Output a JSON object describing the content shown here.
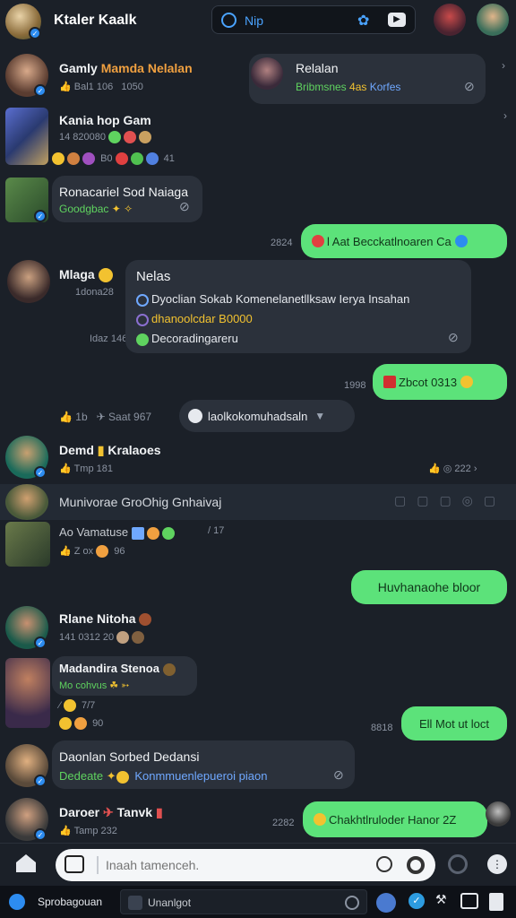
{
  "header": {
    "title": "Ktaler Kaalk",
    "search_value": "Nip"
  },
  "chats": {
    "c1_name": "Gamly",
    "c1_name2": "Mamda Nelalan",
    "c1_meta": "Bal1 106",
    "c1_meta2": "1050",
    "c2_name": "Kania hop Gam",
    "c2_meta": "14 820080",
    "c2_reactions": "B0",
    "c2_react2": "41",
    "c3_name": "Ronacariel Sod Naiaga",
    "c3_meta": "Goodgbac",
    "c4_name": "Mlaga",
    "c4_meta": "1dona28",
    "c4_meta2": "Idaz 146",
    "c5_name": "Demd",
    "c5_name2": "Kralaoes",
    "c5_meta": "Tmp 181",
    "c5_right": "222",
    "c6_text": "Munivorae GroOhig Gnhaivaj",
    "c7_text": "Ao Vamatuse",
    "c7_right": "17",
    "c7_meta": "Z ox",
    "c7_meta2": "96",
    "c8_name": "Rlane Nitoha",
    "c8_meta": "141 0312 20",
    "c9_name": "Madandira Stenoa",
    "c9_meta": "Mo cohvus",
    "c9_meta2": "7/7",
    "c9_meta3": "90",
    "c10_name": "Daonlan Sorbed Dedansi",
    "c10_meta": "Dedeate",
    "c10_meta2": "Konmmuenlepueroi piaon",
    "c11_name": "Daroer",
    "c11_name2": "Tanvk",
    "c11_meta": "Tamp 232"
  },
  "right_bubbles": {
    "relaton_title": "Relalan",
    "relaton_sub": "Bribmsnes",
    "relaton_sub2": "4as",
    "relaton_sub3": "Korfes",
    "b_time1": "2824",
    "b_green1": "l Aat Becckatlnoaren Ca",
    "b_green2": "Zbcot 0313",
    "b_time2": "1998",
    "b_green3": "Huvhanaohe bloor",
    "b_green4": "Ell Mot ut loct",
    "b_time3": "8818",
    "b_time4": "2282",
    "b_green5": "Chakhtlruloder Hanor 2Z"
  },
  "card": {
    "title": "Nelas",
    "line1": "Dyoclian Sokab Komenelanetllksaw Ierya Insahan",
    "line2": "dhanoolcdar B0000",
    "line3": "Decoradingareru"
  },
  "pill": {
    "left_label": "Saat 967",
    "left_num": "1b",
    "text": "laolkokomuhadsaln"
  },
  "composer": {
    "placeholder": "Inaah tamenceh."
  },
  "taskbar": {
    "app_label": "Sprobagouan",
    "field_value": "Unanlgot"
  },
  "colors": {
    "bg": "#1b2028",
    "green_bubble": "#5ce27a",
    "accent": "#2d8cf0"
  }
}
